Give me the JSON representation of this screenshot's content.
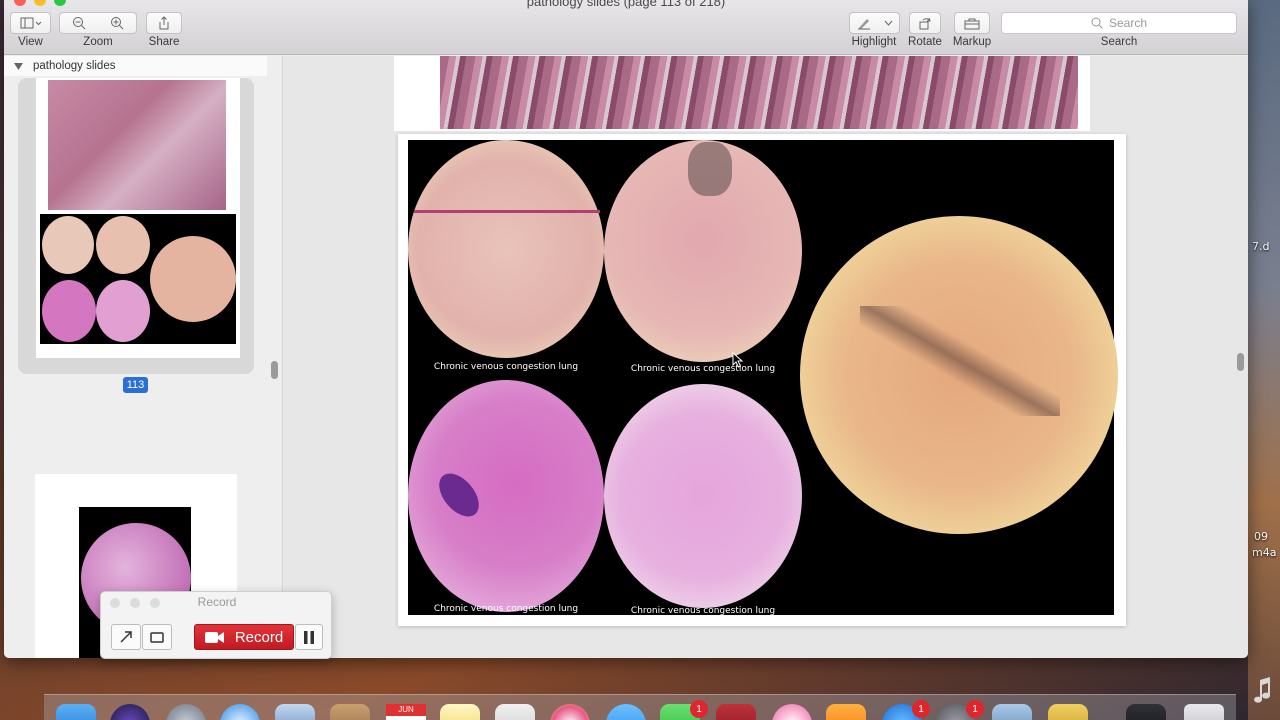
{
  "window": {
    "title": "pathology slides (page 113 of 218)"
  },
  "toolbar": {
    "view_label": "View",
    "zoom_label": "Zoom",
    "share_label": "Share",
    "highlight_label": "Highlight",
    "rotate_label": "Rotate",
    "markup_label": "Markup",
    "search_placeholder": "Search",
    "search_label": "Search"
  },
  "sidebar": {
    "document_name": "pathology slides",
    "current_page": "113"
  },
  "slide": {
    "captions": [
      "Chronic venous congestion lung",
      "Chronic venous congestion lung",
      "Chronic venous congestion lung",
      "Chronic venous congestion lung"
    ]
  },
  "record_widget": {
    "title": "Record",
    "record_label": "Record"
  },
  "desktop": {
    "labels": [
      "7.d",
      "09",
      "m4a"
    ]
  },
  "dock": {
    "calendar_month": "JUN",
    "badges": [
      "1",
      "1",
      "1"
    ]
  },
  "colors": {
    "accent": "#2a6fd6",
    "record_red": "#d0222a",
    "tissue_pink": "#e8a6c4",
    "tissue_light": "#f2d9a8"
  }
}
